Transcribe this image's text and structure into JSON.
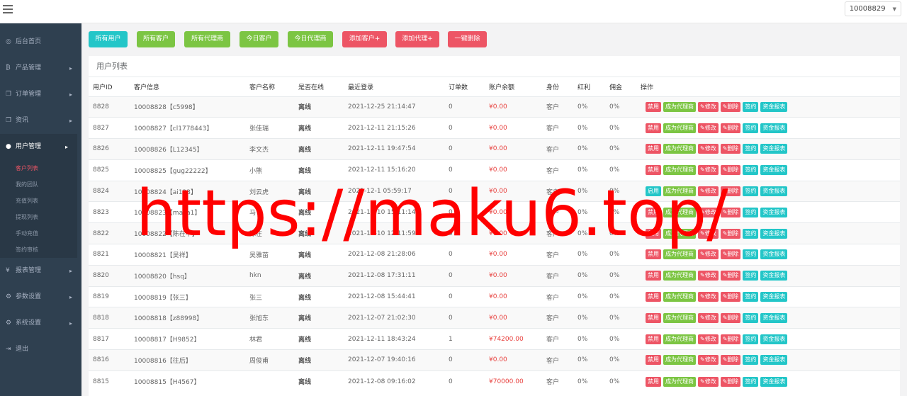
{
  "topbar": {
    "user_id": "10008829"
  },
  "colors": {
    "sidebar": "#2f4050",
    "cyan": "#23c6c8",
    "green": "#7cc543",
    "red": "#ed5565",
    "amount": "#e8413e"
  },
  "sidebar": {
    "items": [
      {
        "icon": "dashboard-icon",
        "glyph": "◎",
        "label": "后台首页",
        "arrow": false
      },
      {
        "icon": "bitcoin-icon",
        "glyph": "₿",
        "label": "产品管理",
        "arrow": true
      },
      {
        "icon": "copy-icon",
        "glyph": "❐",
        "label": "订单管理",
        "arrow": true
      },
      {
        "icon": "file-icon",
        "glyph": "❐",
        "label": "资讯",
        "arrow": true
      }
    ],
    "active_group": {
      "icon": "user-icon",
      "glyph": "●",
      "label": "用户管理",
      "sub_items": [
        {
          "label": "客户列表",
          "active": true
        },
        {
          "label": "我的团队",
          "active": false
        },
        {
          "label": "充值列表",
          "active": false
        },
        {
          "label": "提现列表",
          "active": false
        },
        {
          "label": "手动充值",
          "active": false
        },
        {
          "label": "签约审核",
          "active": false
        }
      ]
    },
    "items_after": [
      {
        "icon": "yen-icon",
        "glyph": "¥",
        "label": "报表管理",
        "arrow": true
      },
      {
        "icon": "gear-icon",
        "glyph": "⚙",
        "label": "参数设置",
        "arrow": true
      },
      {
        "icon": "gears-icon",
        "glyph": "⚙",
        "label": "系统设置",
        "arrow": true
      },
      {
        "icon": "sign-out-icon",
        "glyph": "⇥",
        "label": "退出",
        "arrow": false
      }
    ]
  },
  "filters": [
    {
      "label": "所有用户",
      "color": "cyan"
    },
    {
      "label": "所有客户",
      "color": "green"
    },
    {
      "label": "所有代理商",
      "color": "green"
    },
    {
      "label": "今日客户",
      "color": "green"
    },
    {
      "label": "今日代理商",
      "color": "green"
    },
    {
      "label": "添加客户+",
      "color": "red"
    },
    {
      "label": "添加代理+",
      "color": "red"
    },
    {
      "label": "一键删除",
      "color": "red"
    }
  ],
  "panel": {
    "title": "用户列表"
  },
  "table": {
    "headers": [
      "用户ID",
      "客户信息",
      "客户名称",
      "是否在线",
      "最近登录",
      "订单数",
      "账户余额",
      "身份",
      "红利",
      "佣金",
      "操作"
    ],
    "actions": {
      "ban": "禁用",
      "enable": "启用",
      "agent": "成为代理商",
      "edit": "✎修改",
      "delete": "✎删除",
      "sign": "签约",
      "report": "资金报表"
    },
    "rows": [
      {
        "id": "8828",
        "info": "10008828【c5998】",
        "name": "",
        "online": "离线",
        "login": "2021-12-25 21:14:47",
        "orders": "0",
        "balance": "¥0.00",
        "role": "客户",
        "bonus": "0%",
        "commission": "0%",
        "status": "禁用"
      },
      {
        "id": "8827",
        "info": "10008827【cl1778443】",
        "name": "张佳瑞",
        "online": "离线",
        "login": "2021-12-11 21:15:26",
        "orders": "0",
        "balance": "¥0.00",
        "role": "客户",
        "bonus": "0%",
        "commission": "0%",
        "status": "禁用"
      },
      {
        "id": "8826",
        "info": "10008826【L12345】",
        "name": "李文杰",
        "online": "离线",
        "login": "2021-12-11 19:47:54",
        "orders": "0",
        "balance": "¥0.00",
        "role": "客户",
        "bonus": "0%",
        "commission": "0%",
        "status": "禁用"
      },
      {
        "id": "8825",
        "info": "10008825【gug22222】",
        "name": "小熊",
        "online": "离线",
        "login": "2021-12-11 15:16:20",
        "orders": "0",
        "balance": "¥0.00",
        "role": "客户",
        "bonus": "0%",
        "commission": "0%",
        "status": "禁用"
      },
      {
        "id": "8824",
        "info": "10008824【ai123】",
        "name": "刘云虎",
        "online": "离线",
        "login": "2021-12-1 05:59:17",
        "orders": "0",
        "balance": "¥0.00",
        "role": "客户",
        "bonus": "0%",
        "commission": "0%",
        "status": "启用"
      },
      {
        "id": "8823",
        "info": "10008823【majia1】",
        "name": "马",
        "online": "离线",
        "login": "2021-12-10 15:11:14",
        "orders": "0",
        "balance": "¥0.00",
        "role": "客户",
        "bonus": "0%",
        "commission": "0%",
        "status": "禁用"
      },
      {
        "id": "8822",
        "info": "10008822【陈在中】",
        "name": "陈在",
        "online": "离线",
        "login": "2021-12-10 12:11:59",
        "orders": "0",
        "balance": "¥0.00",
        "role": "客户",
        "bonus": "0%",
        "commission": "0%",
        "status": "禁用"
      },
      {
        "id": "8821",
        "info": "10008821【吴祥】",
        "name": "吴雅苗",
        "online": "离线",
        "login": "2021-12-08 21:28:06",
        "orders": "0",
        "balance": "¥0.00",
        "role": "客户",
        "bonus": "0%",
        "commission": "0%",
        "status": "禁用"
      },
      {
        "id": "8820",
        "info": "10008820【hsq】",
        "name": "hkn",
        "online": "离线",
        "login": "2021-12-08 17:31:11",
        "orders": "0",
        "balance": "¥0.00",
        "role": "客户",
        "bonus": "0%",
        "commission": "0%",
        "status": "禁用"
      },
      {
        "id": "8819",
        "info": "10008819【张三】",
        "name": "张三",
        "online": "离线",
        "login": "2021-12-08 15:44:41",
        "orders": "0",
        "balance": "¥0.00",
        "role": "客户",
        "bonus": "0%",
        "commission": "0%",
        "status": "禁用"
      },
      {
        "id": "8818",
        "info": "10008818【z88998】",
        "name": "张旭东",
        "online": "离线",
        "login": "2021-12-07 21:02:30",
        "orders": "0",
        "balance": "¥0.00",
        "role": "客户",
        "bonus": "0%",
        "commission": "0%",
        "status": "禁用"
      },
      {
        "id": "8817",
        "info": "10008817【H9852】",
        "name": "林君",
        "online": "离线",
        "login": "2021-12-11 18:43:24",
        "orders": "1",
        "balance": "¥74200.00",
        "role": "客户",
        "bonus": "0%",
        "commission": "0%",
        "status": "禁用"
      },
      {
        "id": "8816",
        "info": "10008816【往后】",
        "name": "周俊甫",
        "online": "离线",
        "login": "2021-12-07 19:40:16",
        "orders": "0",
        "balance": "¥0.00",
        "role": "客户",
        "bonus": "0%",
        "commission": "0%",
        "status": "禁用"
      },
      {
        "id": "8815",
        "info": "10008815【H4567】",
        "name": "",
        "online": "离线",
        "login": "2021-12-08 09:16:02",
        "orders": "0",
        "balance": "¥70000.00",
        "role": "客户",
        "bonus": "0%",
        "commission": "0%",
        "status": "禁用"
      }
    ]
  },
  "watermark": "https://maku6.top/"
}
